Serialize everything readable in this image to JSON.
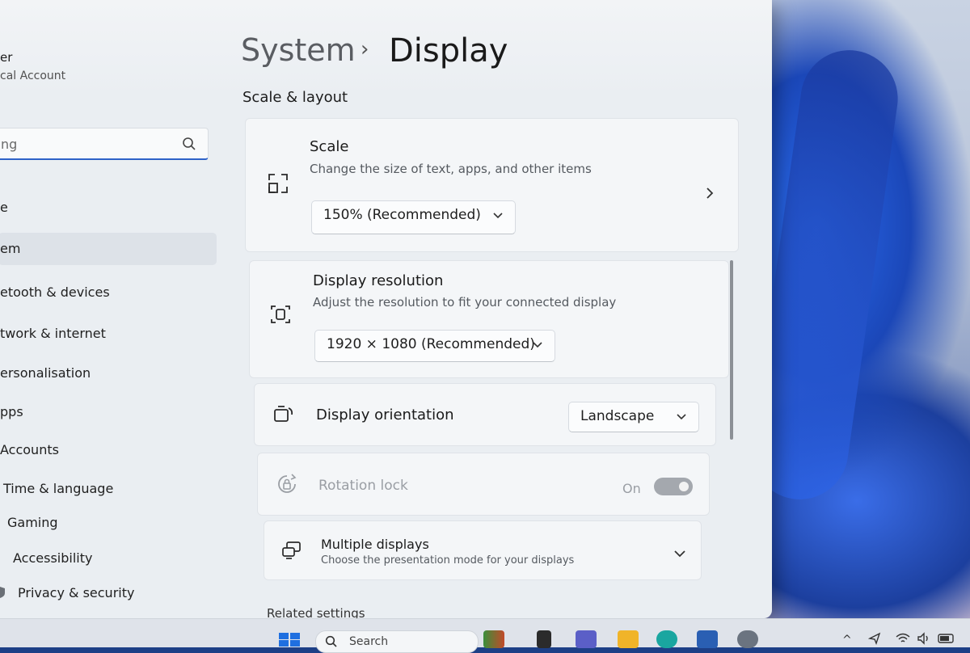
{
  "sidebar": {
    "user_name": "er",
    "user_account": "cal Account",
    "search_placeholder": "ng",
    "items": [
      {
        "label": "e"
      },
      {
        "label": "em"
      },
      {
        "label": "etooth & devices"
      },
      {
        "label": "twork & internet"
      },
      {
        "label": "ersonalisation"
      },
      {
        "label": "pps"
      },
      {
        "label": "Accounts"
      },
      {
        "label": "Time & language"
      },
      {
        "label": "Gaming"
      },
      {
        "label": "Accessibility"
      },
      {
        "label": "Privacy & security"
      }
    ]
  },
  "header": {
    "breadcrumb_parent": "System",
    "breadcrumb_separator": "›",
    "page_title": "Display"
  },
  "section": {
    "title": "Scale & layout"
  },
  "cards": {
    "scale": {
      "title": "Scale",
      "description": "Change the size of text, apps, and other items",
      "value": "150% (Recommended)"
    },
    "resolution": {
      "title": "Display resolution",
      "description": "Adjust the resolution to fit your connected display",
      "value": "1920 × 1080 (Recommended)"
    },
    "orientation": {
      "title": "Display orientation",
      "value": "Landscape"
    },
    "rotation_lock": {
      "title": "Rotation lock",
      "state": "On"
    },
    "multiple_displays": {
      "title": "Multiple displays",
      "description": "Choose the presentation mode for your displays"
    }
  },
  "related": {
    "title": "Related settings"
  },
  "taskbar": {
    "search_label": "Search"
  },
  "colors": {
    "accent": "#2f62c8",
    "window_bg": "#eaeef2",
    "card_bg": "#f4f6f8"
  }
}
